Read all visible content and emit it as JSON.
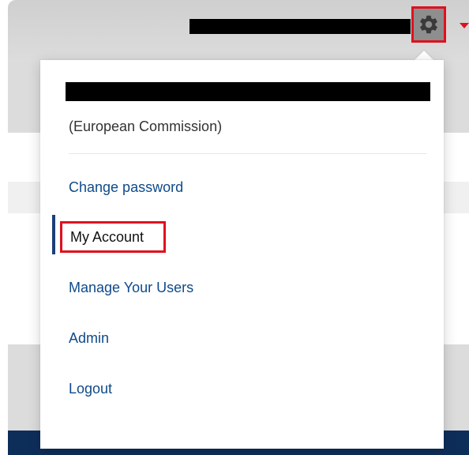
{
  "user_menu": {
    "organization": "(European Commission)",
    "items": [
      {
        "label": "Change password",
        "active": false
      },
      {
        "label": "My Account",
        "active": true
      },
      {
        "label": "Manage Your Users",
        "active": false
      },
      {
        "label": "Admin",
        "active": false
      },
      {
        "label": "Logout",
        "active": false
      }
    ]
  },
  "header": {
    "settings_icon": "gear-icon",
    "dropdown_icon": "caret-down-icon"
  },
  "colors": {
    "highlight_red": "#e0101e",
    "link_blue": "#0e4a8a",
    "footer_navy": "#0e2e5a",
    "active_indicator": "#1c3f78"
  }
}
